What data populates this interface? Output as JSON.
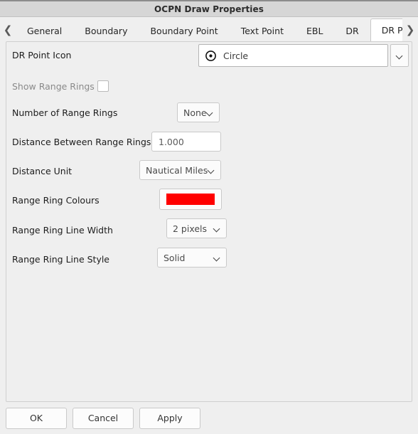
{
  "window": {
    "title": "OCPN Draw Properties"
  },
  "tabbar": {
    "scroll_left_icon": "chevron-left-icon",
    "scroll_right_icon": "chevron-right-icon",
    "tabs": [
      {
        "label": "General",
        "active": false
      },
      {
        "label": "Boundary",
        "active": false
      },
      {
        "label": "Boundary Point",
        "active": false
      },
      {
        "label": "Text Point",
        "active": false
      },
      {
        "label": "EBL",
        "active": false
      },
      {
        "label": "DR",
        "active": false
      },
      {
        "label": "DR Point",
        "active": true
      }
    ]
  },
  "form": {
    "dr_point_icon": {
      "label": "DR Point Icon",
      "value": "Circle",
      "icon": "circle-dot-icon",
      "arrow_icon": "chevron-down-icon"
    },
    "show_range_rings": {
      "label": "Show Range Rings",
      "checked": false,
      "disabled": true
    },
    "number_of_range_rings": {
      "label": "Number of Range Rings",
      "value": "None",
      "arrow_icon": "chevron-down-icon"
    },
    "distance_between_range_rings": {
      "label": "Distance Between Range Rings",
      "value": "1.000"
    },
    "distance_unit": {
      "label": "Distance Unit",
      "value": "Nautical Miles",
      "arrow_icon": "chevron-down-icon"
    },
    "range_ring_colours": {
      "label": "Range Ring Colours",
      "color": "#FF0000"
    },
    "range_ring_line_width": {
      "label": "Range Ring Line Width",
      "value": "2 pixels",
      "arrow_icon": "chevron-down-icon"
    },
    "range_ring_line_style": {
      "label": "Range Ring Line Style",
      "value": "Solid",
      "arrow_icon": "chevron-down-icon"
    }
  },
  "buttons": {
    "ok": "OK",
    "cancel": "Cancel",
    "apply": "Apply"
  }
}
